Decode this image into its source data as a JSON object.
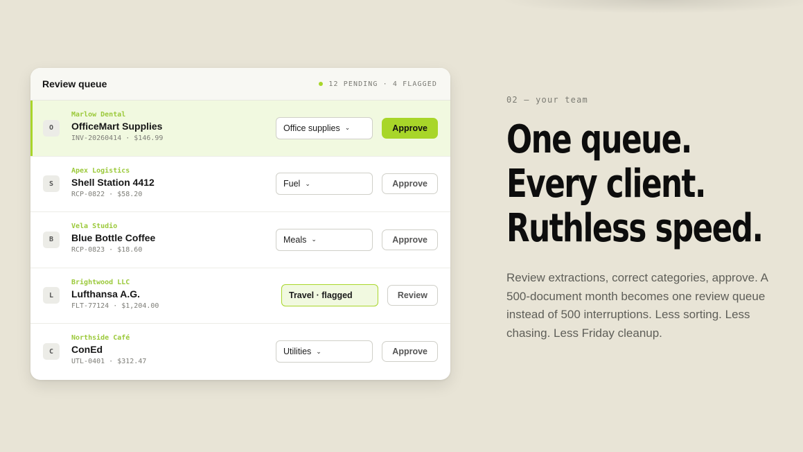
{
  "queue": {
    "title": "Review queue",
    "status": "12 PENDING · 4 FLAGGED",
    "rows": [
      {
        "initial": "O",
        "client": "Marlow Dental",
        "vendor": "OfficeMart Supplies",
        "meta": "INV-20260414 · $146.99",
        "category": "Office supplies",
        "action": "Approve"
      },
      {
        "initial": "S",
        "client": "Apex Logistics",
        "vendor": "Shell Station 4412",
        "meta": "RCP-0822 · $58.20",
        "category": "Fuel",
        "action": "Approve"
      },
      {
        "initial": "B",
        "client": "Vela Studio",
        "vendor": "Blue Bottle Coffee",
        "meta": "RCP-0823 · $18.60",
        "category": "Meals",
        "action": "Approve"
      },
      {
        "initial": "L",
        "client": "Brightwood LLC",
        "vendor": "Lufthansa A.G.",
        "meta": "FLT-77124 · $1,204.00",
        "category": "Travel · flagged",
        "action": "Review"
      },
      {
        "initial": "C",
        "client": "Northside Café",
        "vendor": "ConEd",
        "meta": "UTL-0401 · $312.47",
        "category": "Utilities",
        "action": "Approve"
      }
    ]
  },
  "hero": {
    "eyebrow": "02 — your team",
    "headline": [
      "One queue.",
      "Every client.",
      "Ruthless speed."
    ],
    "body": "Review extractions, correct categories, approve. A 500-document month becomes one review queue instead of 500 interruptions. Less sorting. Less chasing. Less Friday cleanup."
  },
  "colors": {
    "accent": "#a8d629",
    "background": "#e8e4d6",
    "selected_row": "#f1f9e0"
  },
  "icons": {
    "chevron": "chevron-down-icon",
    "status": "status-dot-icon"
  }
}
